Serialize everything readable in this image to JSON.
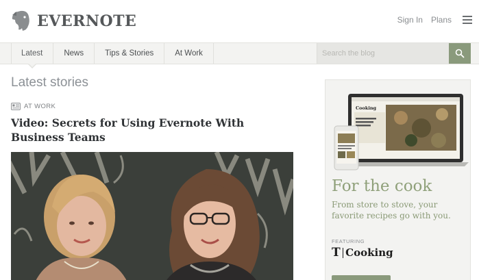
{
  "header": {
    "brand": "EVERNOTE",
    "sign_in": "Sign In",
    "plans": "Plans",
    "icons": {
      "logo": "elephant-logo-icon",
      "menu": "hamburger-menu-icon"
    }
  },
  "nav": {
    "tabs": [
      {
        "label": "Latest",
        "active": true
      },
      {
        "label": "News",
        "active": false
      },
      {
        "label": "Tips & Stories",
        "active": false
      },
      {
        "label": "At Work",
        "active": false
      }
    ],
    "search": {
      "placeholder": "Search the blog",
      "icon": "search-icon"
    }
  },
  "main": {
    "section_title": "Latest stories",
    "article": {
      "category": "AT WORK",
      "category_icon": "id-card-icon",
      "title": "Video: Secrets for Using Evernote With Business Teams"
    }
  },
  "sidebar": {
    "promo_title": "For the cook",
    "promo_desc": "From store to stove, your favorite recipes go with you.",
    "featuring_label": "FEATURING",
    "cooking_t": "T",
    "cooking_word": "Cooking",
    "laptop_screen_title": "Cooking"
  },
  "colors": {
    "accent_green": "#8a9a7c",
    "promo_text_green": "#8fa07a",
    "nav_bg": "#f3f3f1"
  }
}
